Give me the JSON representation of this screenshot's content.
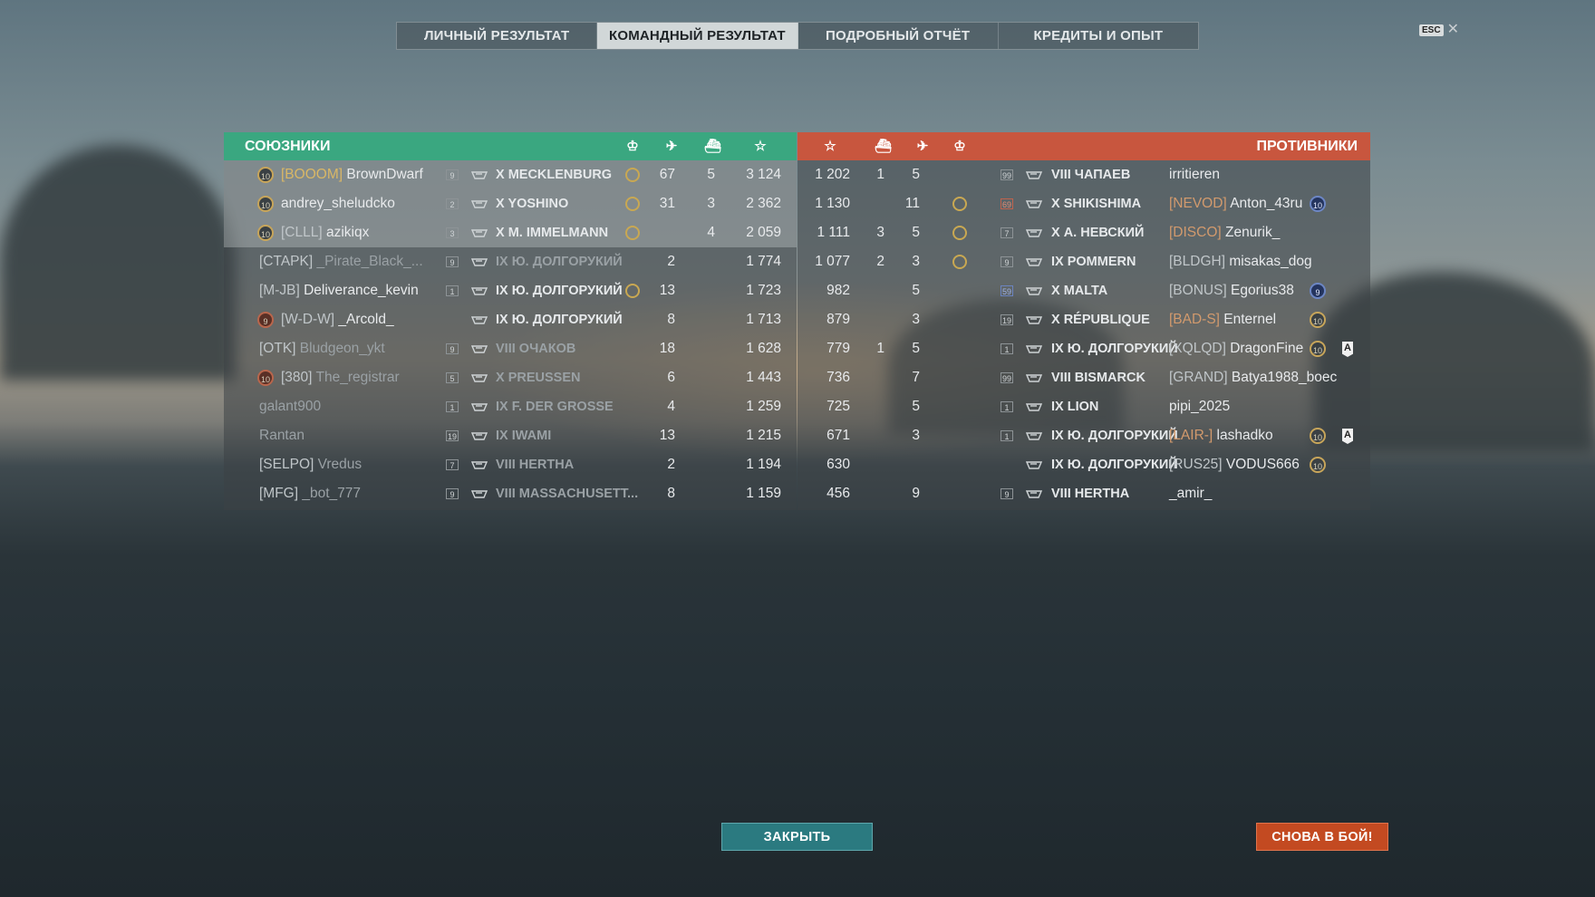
{
  "tabs": [
    {
      "label": "ЛИЧНЫЙ РЕЗУЛЬТАТ",
      "active": false
    },
    {
      "label": "КОМАНДНЫЙ РЕЗУЛЬТАТ",
      "active": true
    },
    {
      "label": "ПОДРОБНЫЙ ОТЧЁТ",
      "active": false
    },
    {
      "label": "КРЕДИТЫ И ОПЫТ",
      "active": false
    }
  ],
  "esc": {
    "key": "ESC",
    "icon": "close-icon"
  },
  "allies": {
    "title": "СОЮЗНИКИ",
    "color": "#3aa780",
    "header_icons": [
      "laurel-icon",
      "plane-kill-icon",
      "ship-kill-icon",
      "star-icon"
    ],
    "rows": [
      {
        "badge": "10",
        "badge_style": "gold",
        "clan": "[BOOOM]",
        "clan_style": "gold",
        "name": "BrownDwarf",
        "division": "9",
        "div_style": "",
        "ship": "X MECKLENBURG",
        "laurel": true,
        "c1": "67",
        "c2": "5",
        "xp": "3 124",
        "highlight": true,
        "dim": false
      },
      {
        "badge": "10",
        "badge_style": "gold",
        "clan": "",
        "clan_style": "",
        "name": "andrey_sheludcko",
        "division": "2",
        "div_style": "",
        "ship": "X YOSHINO",
        "laurel": true,
        "c1": "31",
        "c2": "3",
        "xp": "2 362",
        "highlight": true,
        "dim": false
      },
      {
        "badge": "10",
        "badge_style": "gold",
        "clan": "[CLLL]",
        "clan_style": "",
        "name": "azikiqx",
        "division": "3",
        "div_style": "",
        "ship": "X M. IMMELMANN",
        "laurel": true,
        "c1": "",
        "c2": "4",
        "xp": "2 059",
        "highlight": true,
        "dim": false
      },
      {
        "badge": "",
        "badge_style": "",
        "clan": "[CTAPK]",
        "clan_style": "",
        "name": "_Pirate_Black_...",
        "division": "9",
        "div_style": "",
        "ship": "IX Ю. ДОЛГОРУКИЙ",
        "laurel": false,
        "c1": "2",
        "c2": "",
        "xp": "1 774",
        "highlight": false,
        "dim": true
      },
      {
        "badge": "",
        "badge_style": "",
        "clan": "[M-JB]",
        "clan_style": "",
        "name": "Deliverance_kevin",
        "division": "1",
        "div_style": "",
        "ship": "IX Ю. ДОЛГОРУКИЙ",
        "laurel": true,
        "c1": "13",
        "c2": "",
        "xp": "1 723",
        "highlight": false,
        "dim": false
      },
      {
        "badge": "9",
        "badge_style": "red",
        "clan": "[W-D-W]",
        "clan_style": "",
        "name": "_Arcold_",
        "division": "",
        "div_style": "",
        "ship": "IX Ю. ДОЛГОРУКИЙ",
        "laurel": false,
        "c1": "8",
        "c2": "",
        "xp": "1 713",
        "highlight": false,
        "dim": false
      },
      {
        "badge": "",
        "badge_style": "",
        "clan": "[OTK]",
        "clan_style": "",
        "name": "Bludgeon_ykt",
        "division": "9",
        "div_style": "",
        "ship": "VIII ОЧАКОВ",
        "laurel": false,
        "c1": "18",
        "c2": "",
        "xp": "1 628",
        "highlight": false,
        "dim": true
      },
      {
        "badge": "10",
        "badge_style": "red",
        "clan": "[380]",
        "clan_style": "",
        "name": "The_registrar",
        "division": "5",
        "div_style": "",
        "ship": "X PREUSSEN",
        "laurel": false,
        "c1": "6",
        "c2": "",
        "xp": "1 443",
        "highlight": false,
        "dim": true
      },
      {
        "badge": "",
        "badge_style": "",
        "clan": "",
        "clan_style": "",
        "name": "galant900",
        "division": "1",
        "div_style": "",
        "ship": "IX F. DER GROSSE",
        "laurel": false,
        "c1": "4",
        "c2": "",
        "xp": "1 259",
        "highlight": false,
        "dim": true
      },
      {
        "badge": "",
        "badge_style": "",
        "clan": "",
        "clan_style": "",
        "name": "Rantan",
        "division": "19",
        "div_style": "",
        "ship": "IX IWAMI",
        "laurel": false,
        "c1": "13",
        "c2": "",
        "xp": "1 215",
        "highlight": false,
        "dim": true
      },
      {
        "badge": "",
        "badge_style": "",
        "clan": "[SELPO]",
        "clan_style": "",
        "name": "Vredus",
        "division": "7",
        "div_style": "",
        "ship": "VIII HERTHA",
        "laurel": false,
        "c1": "2",
        "c2": "",
        "xp": "1 194",
        "highlight": false,
        "dim": true
      },
      {
        "badge": "",
        "badge_style": "",
        "clan": "[MFG]",
        "clan_style": "",
        "name": "_bot_777",
        "division": "9",
        "div_style": "",
        "ship": "VIII MASSACHUSETT...",
        "laurel": false,
        "c1": "8",
        "c2": "",
        "xp": "1 159",
        "highlight": false,
        "dim": true
      }
    ]
  },
  "enemies": {
    "title": "ПРОТИВНИКИ",
    "color": "#c8563e",
    "header_icons": [
      "star-icon",
      "ship-kill-icon",
      "plane-kill-icon",
      "laurel-icon"
    ],
    "rows": [
      {
        "xp": "1 202",
        "c2": "1",
        "c1": "5",
        "laurel": false,
        "division": "99",
        "div_style": "",
        "ship": "VIII ЧАПАЕВ",
        "clan": "",
        "clan_style": "",
        "name": "irritieren",
        "badge": "",
        "badge_style": "",
        "tag": ""
      },
      {
        "xp": "1 130",
        "c2": "",
        "c1": "11",
        "laurel": true,
        "division": "69",
        "div_style": "red",
        "ship": "X SHIKISHIMA",
        "clan": "[NEVOD]",
        "clan_style": "orange",
        "name": "Anton_43ru",
        "badge": "10",
        "badge_style": "blue",
        "tag": ""
      },
      {
        "xp": "1 111",
        "c2": "3",
        "c1": "5",
        "laurel": true,
        "division": "7",
        "div_style": "",
        "ship": "X А. НЕВСКИЙ",
        "clan": "[DISCO]",
        "clan_style": "orange",
        "name": "Zenurik_",
        "badge": "",
        "badge_style": "",
        "tag": ""
      },
      {
        "xp": "1 077",
        "c2": "2",
        "c1": "3",
        "laurel": true,
        "division": "9",
        "div_style": "",
        "ship": "IX POMMERN",
        "clan": "[BLDGH]",
        "clan_style": "",
        "name": "misakas_dog",
        "badge": "",
        "badge_style": "",
        "tag": ""
      },
      {
        "xp": "982",
        "c2": "",
        "c1": "5",
        "laurel": false,
        "division": "59",
        "div_style": "blue",
        "ship": "X MALTA",
        "clan": "[BONUS]",
        "clan_style": "",
        "name": "Egorius38",
        "badge": "9",
        "badge_style": "blue",
        "tag": ""
      },
      {
        "xp": "879",
        "c2": "",
        "c1": "3",
        "laurel": false,
        "division": "19",
        "div_style": "",
        "ship": "X RÉPUBLIQUE",
        "clan": "[BAD-S]",
        "clan_style": "orange",
        "name": "Enternel",
        "badge": "10",
        "badge_style": "gold",
        "tag": ""
      },
      {
        "xp": "779",
        "c2": "1",
        "c1": "5",
        "laurel": false,
        "division": "1",
        "div_style": "",
        "ship": "IX Ю. ДОЛГОРУКИЙ",
        "clan": "[XQLQD]",
        "clan_style": "",
        "name": "DragonFine",
        "badge": "10",
        "badge_style": "gold",
        "tag": "A"
      },
      {
        "xp": "736",
        "c2": "",
        "c1": "7",
        "laurel": false,
        "division": "99",
        "div_style": "",
        "ship": "VIII BISMARCK",
        "clan": "[GRAND]",
        "clan_style": "",
        "name": "Batya1988_boec",
        "badge": "",
        "badge_style": "",
        "tag": ""
      },
      {
        "xp": "725",
        "c2": "",
        "c1": "5",
        "laurel": false,
        "division": "1",
        "div_style": "",
        "ship": "IX LION",
        "clan": "",
        "clan_style": "",
        "name": "pipi_2025",
        "badge": "",
        "badge_style": "",
        "tag": ""
      },
      {
        "xp": "671",
        "c2": "",
        "c1": "3",
        "laurel": false,
        "division": "1",
        "div_style": "",
        "ship": "IX Ю. ДОЛГОРУКИЙ",
        "clan": "[LAIR-]",
        "clan_style": "orange",
        "name": "lashadko",
        "badge": "10",
        "badge_style": "gold",
        "tag": "A"
      },
      {
        "xp": "630",
        "c2": "",
        "c1": "",
        "laurel": false,
        "division": "",
        "div_style": "",
        "ship": "IX Ю. ДОЛГОРУКИЙ",
        "clan": "[RUS25]",
        "clan_style": "",
        "name": "VODUS666",
        "badge": "10",
        "badge_style": "gold",
        "tag": ""
      },
      {
        "xp": "456",
        "c2": "",
        "c1": "9",
        "laurel": false,
        "division": "9",
        "div_style": "",
        "ship": "VIII HERTHA",
        "clan": "",
        "clan_style": "",
        "name": "_amir_",
        "badge": "",
        "badge_style": "",
        "tag": ""
      }
    ]
  },
  "buttons": {
    "close": "ЗАКРЫТЬ",
    "again": "СНОВА В БОЙ!"
  }
}
